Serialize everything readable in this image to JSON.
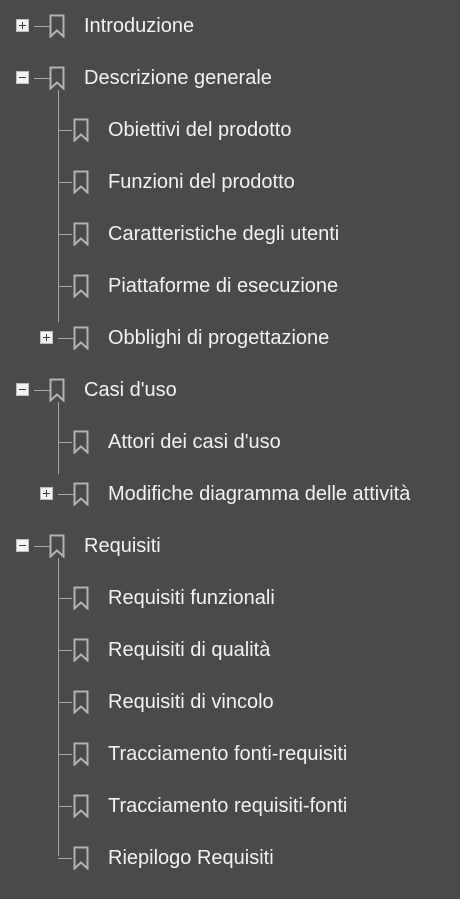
{
  "bookmarks": [
    {
      "label": "Introduzione",
      "level": 0,
      "toggle": "expand"
    },
    {
      "label": "Descrizione generale",
      "level": 0,
      "toggle": "collapse"
    },
    {
      "label": "Obiettivi del prodotto",
      "level": 1,
      "toggle": null
    },
    {
      "label": "Funzioni del prodotto",
      "level": 1,
      "toggle": null
    },
    {
      "label": "Caratteristiche degli utenti",
      "level": 1,
      "toggle": null
    },
    {
      "label": "Piattaforme di esecuzione",
      "level": 1,
      "toggle": null
    },
    {
      "label": "Obblighi di progettazione",
      "level": 1,
      "toggle": "expand"
    },
    {
      "label": "Casi d'uso",
      "level": 0,
      "toggle": "collapse"
    },
    {
      "label": "Attori dei casi d'uso",
      "level": 1,
      "toggle": null
    },
    {
      "label": "Modifiche diagramma delle attività",
      "level": 1,
      "toggle": "expand"
    },
    {
      "label": "Requisiti",
      "level": 0,
      "toggle": "collapse"
    },
    {
      "label": "Requisiti funzionali",
      "level": 1,
      "toggle": null
    },
    {
      "label": "Requisiti di qualità",
      "level": 1,
      "toggle": null
    },
    {
      "label": "Requisiti di vincolo",
      "level": 1,
      "toggle": null
    },
    {
      "label": "Tracciamento fonti-requisiti",
      "level": 1,
      "toggle": null
    },
    {
      "label": "Tracciamento requisiti-fonti",
      "level": 1,
      "toggle": null
    },
    {
      "label": "Riepilogo Requisiti",
      "level": 1,
      "toggle": null
    }
  ],
  "icons": {
    "bookmark": "bookmark-icon",
    "expand": "expand-plus-icon",
    "collapse": "collapse-minus-icon"
  }
}
